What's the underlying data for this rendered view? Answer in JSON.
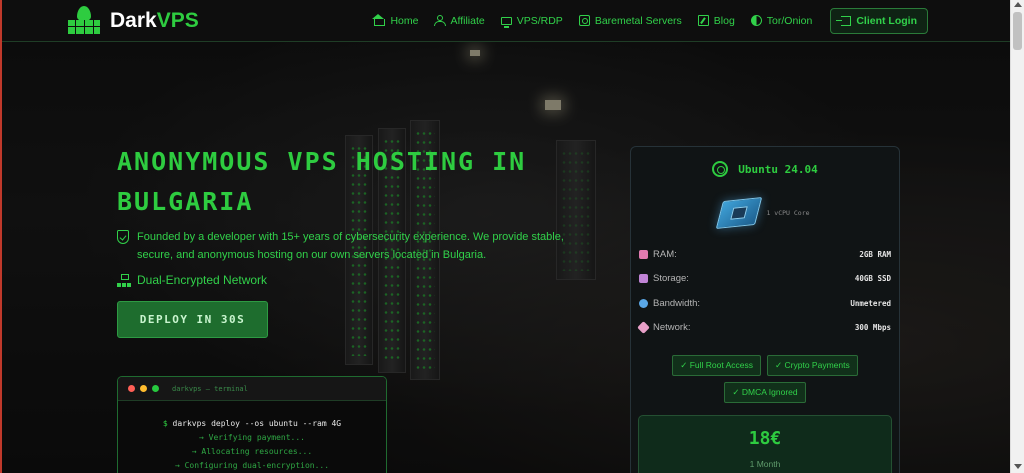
{
  "nav": {
    "logo_part1": "Dark",
    "logo_part2": "VPS",
    "items": [
      {
        "label": "Home",
        "icon": "home-icon"
      },
      {
        "label": "Affiliate",
        "icon": "affiliate-icon"
      },
      {
        "label": "VPS/RDP",
        "icon": "monitor-icon"
      },
      {
        "label": "Baremetal Servers",
        "icon": "server-icon"
      },
      {
        "label": "Blog",
        "icon": "edit-icon"
      },
      {
        "label": "Tor/Onion",
        "icon": "tor-icon"
      }
    ],
    "login_label": "Client Login"
  },
  "hero": {
    "title": "ANONYMOUS VPS HOSTING IN BULGARIA",
    "description": "Founded by a developer with 15+ years of cybersecurity experience. We provide stable, secure, and anonymous hosting on our own servers located in Bulgaria.",
    "feature": "Dual-Encrypted Network",
    "cta_label": "DEPLOY IN 30S"
  },
  "terminal": {
    "title": "darkvps — terminal",
    "prompt": "$",
    "command": "darkvps deploy --os ubuntu --ram 4G",
    "output": [
      "→ Verifying payment...",
      "→ Allocating resources...",
      "→ Configuring dual-encryption..."
    ]
  },
  "plan": {
    "os": "Ubuntu 24.04",
    "cpu": "1 vCPU Core",
    "specs": [
      {
        "label": "RAM:",
        "value": "2GB RAM",
        "icon": "brain-icon",
        "color": "#e07ab0"
      },
      {
        "label": "Storage:",
        "value": "40GB SSD",
        "icon": "disk-icon",
        "color": "#c084d6"
      },
      {
        "label": "Bandwidth:",
        "value": "Unmetered",
        "icon": "globe-icon",
        "color": "#5aa7e6"
      },
      {
        "label": "Network:",
        "value": "300 Mbps",
        "icon": "rocket-icon",
        "color": "#e8a0c8"
      }
    ],
    "badges": [
      "✓ Full Root Access",
      "✓ Crypto Payments",
      "✓ DMCA Ignored"
    ],
    "price": "18€",
    "period": "1 Month"
  },
  "colors": {
    "accent": "#2ecc40",
    "background": "#0e0e0e"
  }
}
